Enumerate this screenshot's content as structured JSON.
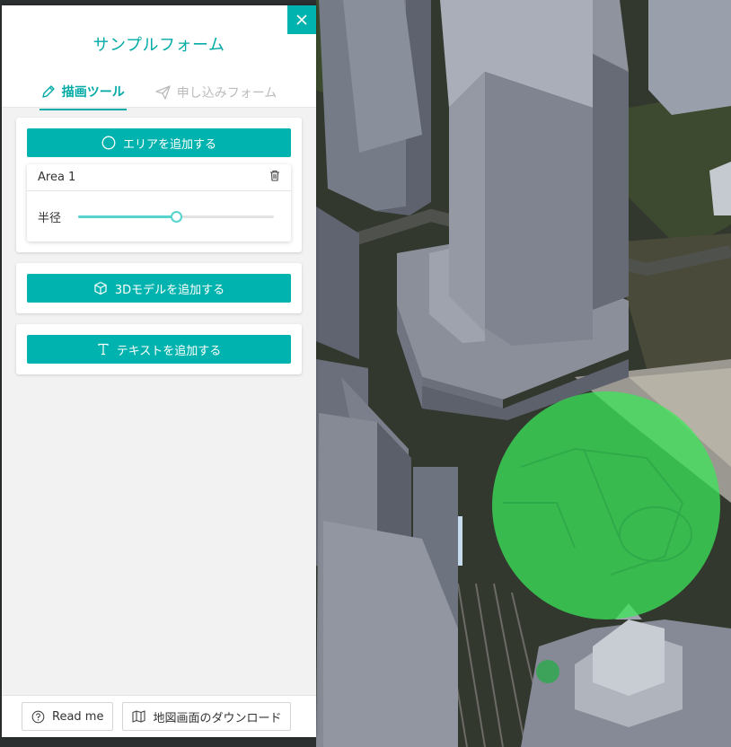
{
  "panel": {
    "title": "サンプルフォーム",
    "close_icon": "close-icon"
  },
  "tabs": [
    {
      "label": "描画ツール",
      "icon": "pencil-icon",
      "active": true
    },
    {
      "label": "申し込みフォーム",
      "icon": "paper-plane-icon",
      "active": false
    }
  ],
  "sections": {
    "area": {
      "button_label": "エリアを追加する",
      "icon": "circle-icon",
      "items": [
        {
          "name": "Area 1",
          "delete_icon": "trash-icon",
          "radius_label": "半径",
          "radius_fraction": 0.5
        }
      ]
    },
    "model": {
      "button_label": "3Dモデルを追加する",
      "icon": "cube-icon"
    },
    "text": {
      "button_label": "テキストを追加する",
      "icon": "text-icon"
    }
  },
  "footer": {
    "readme_label": "Read me",
    "readme_icon": "question-circle-icon",
    "download_label": "地図画面のダウンロード",
    "download_icon": "map-icon"
  },
  "colors": {
    "accent": "#00b3ae",
    "slider": "#55d3cd",
    "area_overlay": "#3ce65a"
  }
}
